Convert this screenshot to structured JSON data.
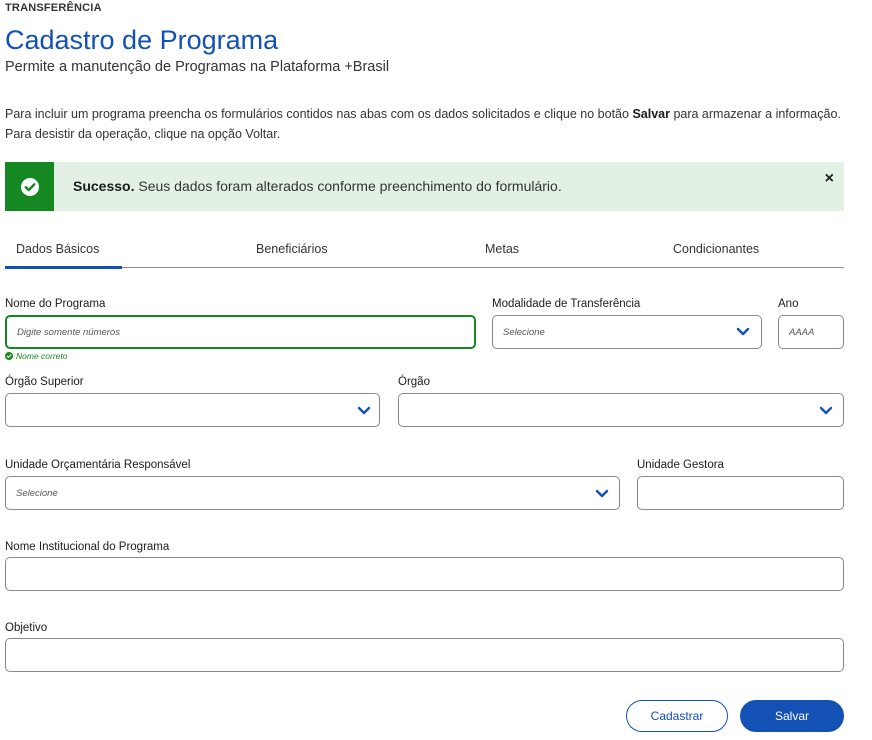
{
  "header": {
    "eyebrow": "TRANSFERÊNCIA",
    "title": "Cadastro de Programa",
    "subtitle": "Permite a manutenção de Programas na Plataforma +Brasil"
  },
  "intro": {
    "part1": "Para incluir um programa preencha os formulários contidos nas abas com os dados solicitados e clique no botão ",
    "bold": "Salvar",
    "part2": " para armazenar a informação. Para desistir da operação, clique na opção Voltar."
  },
  "alert": {
    "title": "Sucesso.",
    "message": " Seus dados foram alterados conforme preenchimento do formulário.",
    "close": "×",
    "color": "#168821"
  },
  "tabs": [
    {
      "label": "Dados Básicos"
    },
    {
      "label": "Beneficiários"
    },
    {
      "label": "Metas"
    },
    {
      "label": "Condicionantes"
    }
  ],
  "form": {
    "nome_programa": {
      "label": "Nome do Programa",
      "placeholder": "Digite somente números",
      "hint": "Nome correto"
    },
    "modalidade": {
      "label": "Modalidade de Transferência",
      "placeholder": "Selecione"
    },
    "ano": {
      "label": "Ano",
      "placeholder": "AAAA"
    },
    "orgao_superior": {
      "label": "Órgão Superior",
      "placeholder": ""
    },
    "orgao": {
      "label": "Órgão",
      "placeholder": ""
    },
    "unidade_orcamentaria": {
      "label": "Unidade Orçamentária Responsável",
      "placeholder": "Selecione"
    },
    "unidade_gestora": {
      "label": "Unidade Gestora",
      "placeholder": ""
    },
    "nome_institucional": {
      "label": "Nome Institucional do Programa",
      "placeholder": ""
    },
    "objetivo": {
      "label": "Objetivo",
      "placeholder": ""
    }
  },
  "actions": {
    "cadastrar": "Cadastrar",
    "salvar": "Salvar"
  },
  "colors": {
    "primary": "#1351b4",
    "success": "#168821",
    "success_bg": "#e3f1e5"
  }
}
